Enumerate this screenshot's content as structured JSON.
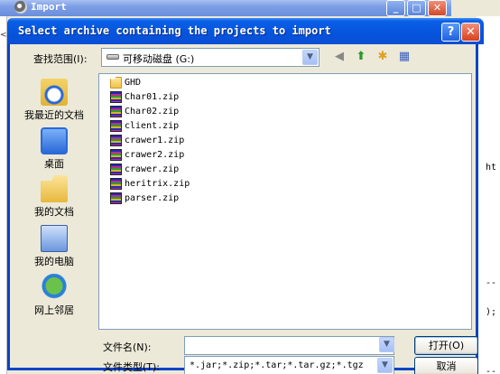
{
  "background": {
    "window_title": "Import",
    "right_fragments": [
      "ht",
      "--",
      ");",
      "--"
    ],
    "left_fragment": "<"
  },
  "dialog": {
    "title": "Select archive containing the projects to import",
    "help_label": "?",
    "close_label": "✕"
  },
  "lookin": {
    "label": "查找范围(I):",
    "value": "可移动磁盘 (G:)"
  },
  "places": [
    {
      "label": "我最近的文档",
      "icon": "recent-documents-icon"
    },
    {
      "label": "桌面",
      "icon": "desktop-icon"
    },
    {
      "label": "我的文档",
      "icon": "my-documents-icon"
    },
    {
      "label": "我的电脑",
      "icon": "my-computer-icon"
    },
    {
      "label": "网上邻居",
      "icon": "network-places-icon"
    }
  ],
  "files": [
    {
      "name": "GHD",
      "type": "folder"
    },
    {
      "name": "Char01.zip",
      "type": "zip"
    },
    {
      "name": "Char02.zip",
      "type": "zip"
    },
    {
      "name": "client.zip",
      "type": "zip"
    },
    {
      "name": "crawer1.zip",
      "type": "zip"
    },
    {
      "name": "crawer2.zip",
      "type": "zip"
    },
    {
      "name": "crawer.zip",
      "type": "zip"
    },
    {
      "name": "heritrix.zip",
      "type": "zip"
    },
    {
      "name": "parser.zip",
      "type": "zip"
    }
  ],
  "filename": {
    "label": "文件名(N):",
    "value": ""
  },
  "filetype": {
    "label": "文件类型(T):",
    "value": "*.jar;*.zip;*.tar;*.tar.gz;*.tgz"
  },
  "buttons": {
    "open": "打开(O)",
    "cancel": "取消"
  }
}
